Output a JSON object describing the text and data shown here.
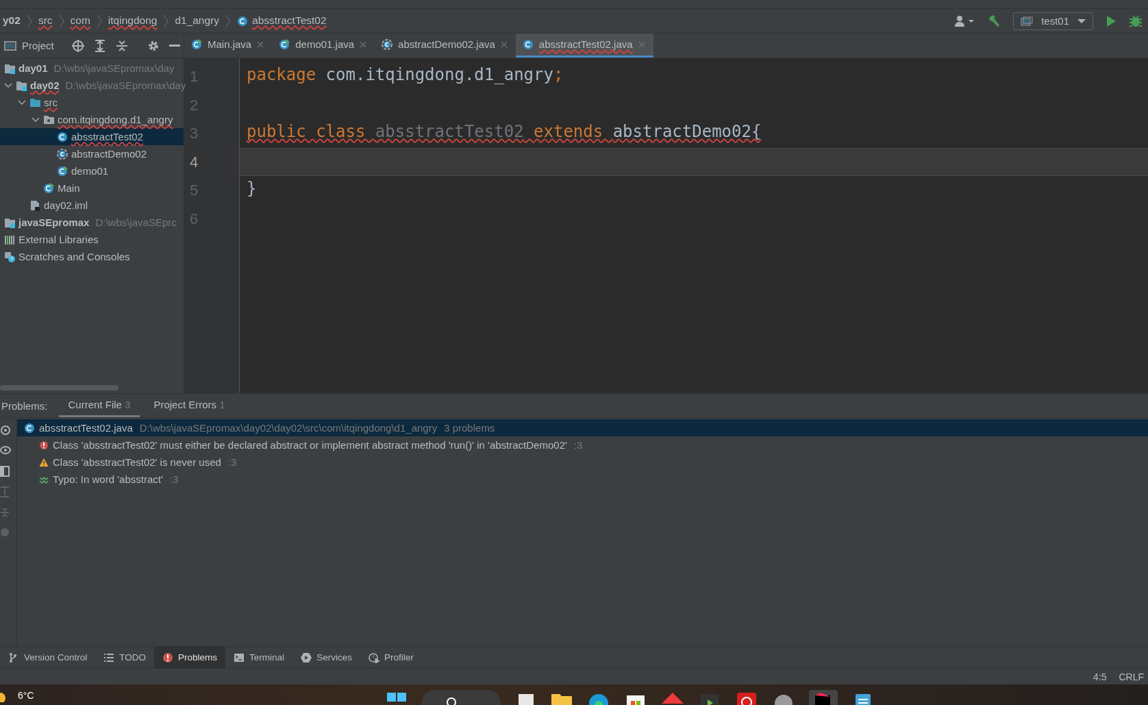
{
  "breadcrumbs": [
    {
      "text": "y02",
      "typo": false,
      "kind": "module"
    },
    {
      "text": "src",
      "typo": true,
      "kind": "folder"
    },
    {
      "text": "com",
      "typo": true,
      "kind": "folder"
    },
    {
      "text": "itqingdong",
      "typo": true,
      "kind": "folder"
    },
    {
      "text": "d1_angry",
      "typo": false,
      "kind": "folder"
    },
    {
      "text": "absstractTest02",
      "typo": true,
      "kind": "class"
    }
  ],
  "run_config": {
    "label": "test01"
  },
  "project_panel": {
    "title": "Project",
    "tree": [
      {
        "name": "day01",
        "path": "D:\\wbs\\javaSEpromax\\day",
        "kind": "module",
        "bold": true,
        "typo": false,
        "selected": false
      },
      {
        "name": "day02",
        "path": "D:\\wbs\\javaSEpromax\\day",
        "kind": "module",
        "bold": true,
        "typo": true,
        "selected": false,
        "expanded": true,
        "children": [
          {
            "name": "src",
            "kind": "folder",
            "bold": false,
            "typo": true,
            "selected": false,
            "expanded": true,
            "children": [
              {
                "name": "com.itqingdong.d1_angry",
                "kind": "package",
                "bold": false,
                "typo": true,
                "selected": false,
                "expanded": true,
                "children": [
                  {
                    "name": "absstractTest02",
                    "kind": "class",
                    "bold": false,
                    "typo": true,
                    "selected": true
                  },
                  {
                    "name": "abstractDemo02",
                    "kind": "abstract",
                    "bold": false,
                    "typo": false,
                    "selected": false
                  },
                  {
                    "name": "demo01",
                    "kind": "runnable",
                    "bold": false,
                    "typo": false,
                    "selected": false
                  }
                ]
              },
              {
                "name": "Main",
                "kind": "runnable",
                "bold": false,
                "typo": false,
                "selected": false
              }
            ]
          },
          {
            "name": "day02.iml",
            "kind": "file",
            "bold": false,
            "typo": false,
            "selected": false
          }
        ]
      },
      {
        "name": "javaSEpromax",
        "path": "D:\\wbs\\javaSEprc",
        "kind": "module",
        "bold": true,
        "typo": false,
        "selected": false
      },
      {
        "name": "External Libraries",
        "kind": "libraries",
        "bold": false,
        "typo": false,
        "selected": false
      },
      {
        "name": "Scratches and Consoles",
        "kind": "scratches",
        "bold": false,
        "typo": false,
        "selected": false
      }
    ]
  },
  "editor_tabs": [
    {
      "label": "Main.java",
      "kind": "runnable",
      "typo": false,
      "selected": false
    },
    {
      "label": "demo01.java",
      "kind": "runnable",
      "typo": false,
      "selected": false
    },
    {
      "label": "abstractDemo02.java",
      "kind": "abstract",
      "typo": false,
      "selected": false
    },
    {
      "label": "absstractTest02.java",
      "kind": "class",
      "typo": true,
      "selected": true
    }
  ],
  "editor": {
    "line_numbers": [
      "1",
      "2",
      "3",
      "4",
      "5",
      "6"
    ],
    "lines": [
      {
        "current": false,
        "tokens": [
          {
            "kind": "keyword",
            "text": "package ",
            "typo": false
          },
          {
            "kind": "plain",
            "text": "com.itqingdong.d1_angry",
            "typo": false
          },
          {
            "kind": "keyword",
            "text": ";",
            "typo": false
          }
        ]
      },
      {
        "current": false
      },
      {
        "current": false,
        "tokens": [
          {
            "kind": "keyword",
            "text": "public class ",
            "typo": true
          },
          {
            "kind": "unused",
            "text": "absstractTest02",
            "typo": true
          },
          {
            "kind": "keyword",
            "text": " extends ",
            "typo": true
          },
          {
            "kind": "plain",
            "text": "abstractDemo02{",
            "typo": true
          }
        ]
      },
      {
        "current": true
      },
      {
        "current": false,
        "tokens": [
          {
            "kind": "plain",
            "text": "}",
            "typo": false
          }
        ]
      },
      {
        "current": false
      }
    ]
  },
  "problems": {
    "label": "Problems:",
    "tabs": [
      {
        "label": "Current File",
        "count": "3",
        "selected": true
      },
      {
        "label": "Project Errors",
        "count": "1",
        "selected": false
      }
    ],
    "file": {
      "name": "absstractTest02.java",
      "path": "D:\\wbs\\javaSEpromax\\day02\\day02\\src\\com\\itqingdong\\d1_angry",
      "summary": "3 problems",
      "selected": true
    },
    "items": [
      {
        "kind": "error",
        "text": "Class 'absstractTest02' must either be declared abstract or implement abstract method 'run()' in 'abstractDemo02'",
        "line": ":3"
      },
      {
        "kind": "warning",
        "text": "Class 'absstractTest02' is never used",
        "line": ":3"
      },
      {
        "kind": "typo",
        "text": "Typo: In word 'absstract'",
        "line": ":3"
      }
    ]
  },
  "tool_windows": [
    {
      "label": "Version Control",
      "kind": "branch",
      "selected": false
    },
    {
      "label": "TODO",
      "kind": "list",
      "selected": false
    },
    {
      "label": "Problems",
      "kind": "error",
      "selected": true
    },
    {
      "label": "Terminal",
      "kind": "terminal",
      "selected": false
    },
    {
      "label": "Services",
      "kind": "services",
      "selected": false
    },
    {
      "label": "Profiler",
      "kind": "profiler",
      "selected": false
    }
  ],
  "status_bar": {
    "position": "4:5",
    "line_separator": "CRLF"
  },
  "taskbar": {
    "weather": "6°C"
  }
}
